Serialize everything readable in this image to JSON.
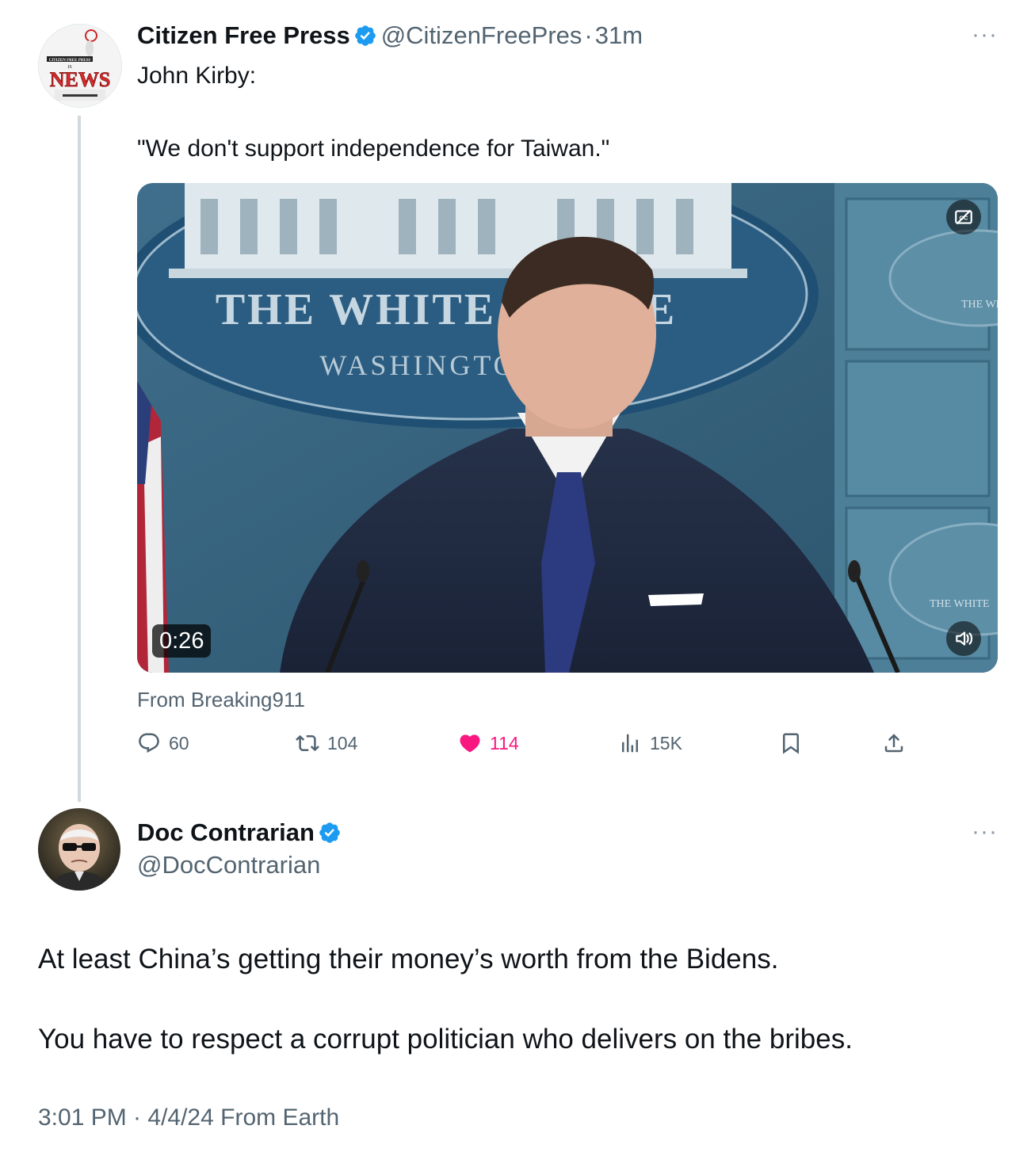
{
  "quoted_tweet": {
    "author_name": "Citizen Free Press",
    "author_handle": "@CitizenFreePres",
    "time_sep": "·",
    "time_ago": "31m",
    "more": "···",
    "line1": "John Kirby:",
    "line2": "\"We don't support independence for Taiwan.\"",
    "avatar_text_top": "CITIZEN FREE PRESS",
    "avatar_text_is": "IS",
    "avatar_text_news": "NEWS",
    "media": {
      "duration": "0:26",
      "seal_line1": "THE WHITE HOUSE",
      "seal_line2": "WASHINGTON",
      "side_seal": "THE WHITE",
      "source": "From Breaking911"
    },
    "actions": {
      "replies": "60",
      "reposts": "104",
      "likes": "114",
      "views": "15K"
    },
    "colors": {
      "like": "#f91880",
      "verified": "#1d9bf0"
    }
  },
  "main_tweet": {
    "author_name": "Doc Contrarian",
    "author_handle": "@DocContrarian",
    "more": "···",
    "paragraph1": "At least China’s getting their money’s worth from the Bidens.",
    "paragraph2": "You have to respect a corrupt politician who delivers on the bribes.",
    "meta": "3:01 PM · 4/4/24 From Earth"
  }
}
